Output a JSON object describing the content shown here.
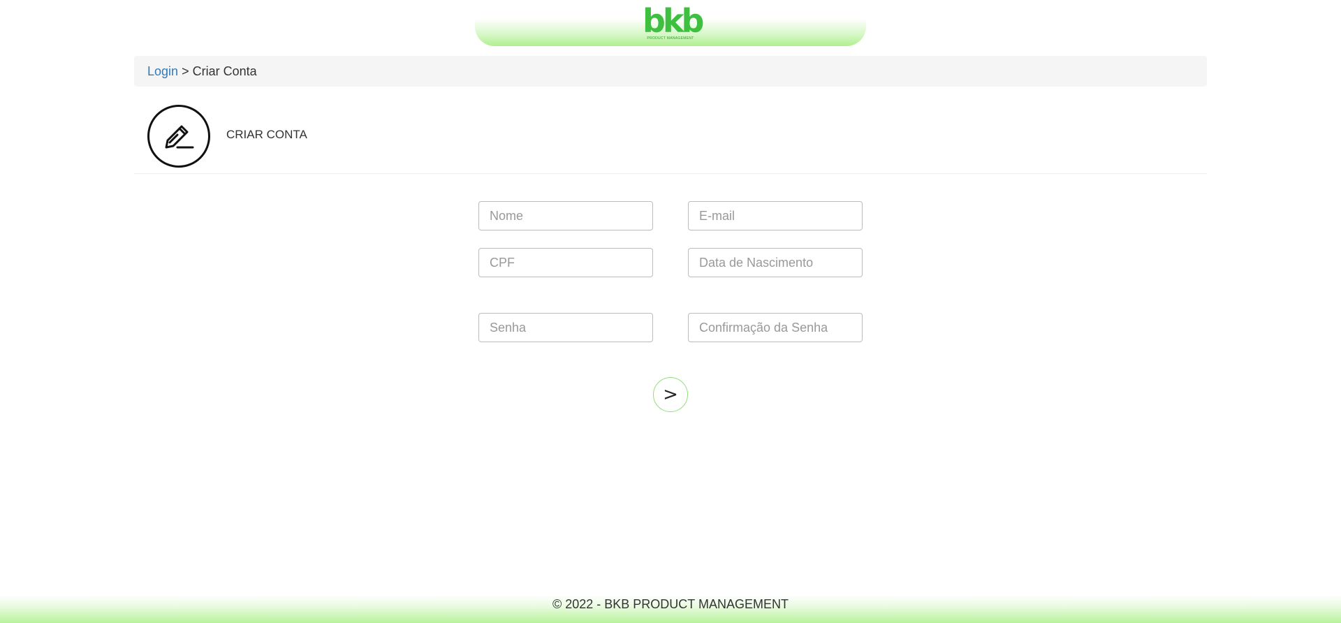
{
  "header": {
    "logo_text": "bkb",
    "logo_subtitle": "PRODUCT MANAGEMENT"
  },
  "breadcrumb": {
    "link_label": "Login",
    "separator": ">",
    "current": "Criar Conta"
  },
  "page": {
    "title": "CRIAR CONTA",
    "icon": "pencil-icon"
  },
  "form": {
    "nome_placeholder": "Nome",
    "email_placeholder": "E-mail",
    "cpf_placeholder": "CPF",
    "nascimento_placeholder": "Data de Nascimento",
    "senha_placeholder": "Senha",
    "confirmacao_placeholder": "Confirmação da Senha",
    "submit_label": ">"
  },
  "footer": {
    "copyright": "© 2022 - BKB PRODUCT MANAGEMENT"
  },
  "colors": {
    "brand_green": "#3fbf3f",
    "accent_light_green": "#aef08f",
    "link_blue": "#337ab7",
    "breadcrumb_bg": "#f5f5f5"
  }
}
